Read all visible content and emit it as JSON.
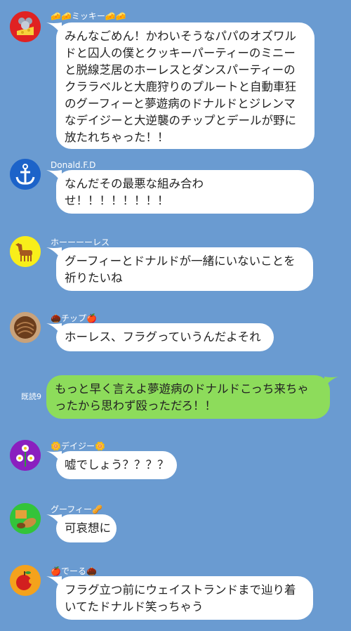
{
  "messages": [
    {
      "sender": "🧀🧀ミッキー🧀🧀",
      "avatar": "mouse-cheese-icon",
      "lines": [
        "みんなごめん！かわいそうなパパのオズワル",
        "ドと囚人の僕とクッキーパーティーのミニー",
        "と脱線芝居のホーレスとダンスパーティーの",
        "クララベルと大鹿狩りのプルートと自動車狂",
        "のグーフィーと夢遊病のドナルドとジレンマ",
        "なデイジーと大逆襲のチップとデールが野に",
        "放たれちゃった！！"
      ]
    },
    {
      "sender": "Donald.F.D",
      "avatar": "anchor-icon",
      "lines": [
        "なんだその最悪な組み合わ",
        "せ！！！！！！！！"
      ]
    },
    {
      "sender": "ホーーーーレス",
      "avatar": "horse-icon",
      "lines": [
        "グーフィーとドナルドが一緒にいないことを",
        "祈りたいね"
      ]
    },
    {
      "sender": "🌰チップ🍎",
      "avatar": "chestnut-icon",
      "lines": [
        "ホーレス、フラグっていうんだよそれ"
      ]
    },
    {
      "sender": "🌼デイジー🌼",
      "avatar": "flowers-icon",
      "lines": [
        "嘘でしょう？？？？"
      ]
    },
    {
      "sender": "グーフィー🥜",
      "avatar": "peanut-icon",
      "lines": [
        "可哀想に"
      ]
    },
    {
      "sender": "🍎でーる🌰",
      "avatar": "apple-icon",
      "lines": [
        "フラグ立つ前にウェイストランドまで辿り着",
        "いてたドナルド笑っちゃう"
      ]
    }
  ],
  "mine": {
    "read_label": "既読9",
    "lines": [
      "もっと早く言えよ夢遊病のドナルドこっち来ちゃ",
      "ったから思わず殴っただろ！！"
    ]
  },
  "colors": {
    "background": "#6a9bd1",
    "bubble": "#ffffff",
    "my_bubble": "#8ddc5b"
  }
}
